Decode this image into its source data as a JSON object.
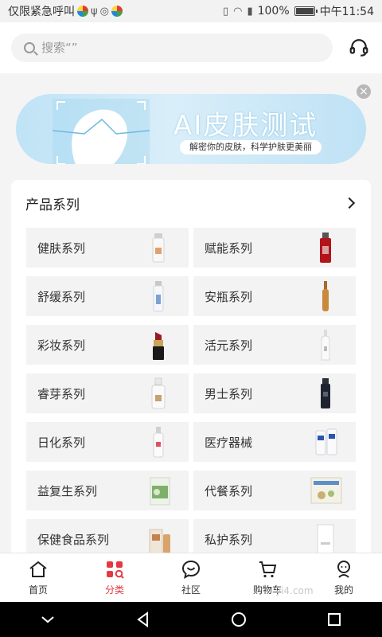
{
  "status_bar": {
    "left_text": "仅限紧急呼叫",
    "battery": "100%",
    "time": "中午11:54"
  },
  "search": {
    "placeholder": "搜索“”"
  },
  "banner": {
    "title": "AI皮肤测试",
    "subtitle": "解密你的皮肤，科学护肤更美丽"
  },
  "products": {
    "title": "产品系列",
    "categories": [
      {
        "label": "健肤系列",
        "icon": "white-bottle-icon"
      },
      {
        "label": "赋能系列",
        "icon": "red-bottle-icon"
      },
      {
        "label": "舒缓系列",
        "icon": "spray-bottle-icon"
      },
      {
        "label": "安瓶系列",
        "icon": "ampoule-icon"
      },
      {
        "label": "彩妆系列",
        "icon": "lipstick-icon"
      },
      {
        "label": "活元系列",
        "icon": "lotion-bottle-icon"
      },
      {
        "label": "睿芽系列",
        "icon": "pump-bottle-icon"
      },
      {
        "label": "男士系列",
        "icon": "dark-bottle-icon"
      },
      {
        "label": "日化系列",
        "icon": "spray-bottle-icon"
      },
      {
        "label": "医疗器械",
        "icon": "tube-set-icon"
      },
      {
        "label": "益复生系列",
        "icon": "supplement-box-icon"
      },
      {
        "label": "代餐系列",
        "icon": "meal-box-icon"
      },
      {
        "label": "保健食品系列",
        "icon": "health-food-icon"
      },
      {
        "label": "私护系列",
        "icon": "care-box-icon"
      }
    ]
  },
  "tabs": [
    {
      "label": "首页",
      "icon": "home-icon"
    },
    {
      "label": "分类",
      "icon": "category-icon",
      "active": true
    },
    {
      "label": "社区",
      "icon": "community-icon"
    },
    {
      "label": "购物车",
      "icon": "cart-icon"
    },
    {
      "label": "我的",
      "icon": "profile-icon"
    }
  ],
  "watermark": "yi4.com",
  "colors": {
    "accent": "#e5393f",
    "banner": "#c6e6f7"
  }
}
